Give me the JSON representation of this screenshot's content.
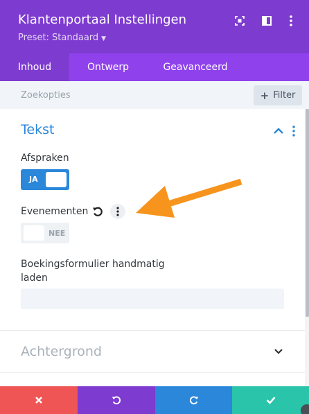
{
  "header": {
    "title": "Klantenportaal Instellingen",
    "preset": "Preset: Standaard",
    "icons": [
      "focus-icon",
      "split-view-icon",
      "more-vertical-icon"
    ]
  },
  "tabs": [
    {
      "label": "Inhoud",
      "active": true
    },
    {
      "label": "Ontwerp",
      "active": false
    },
    {
      "label": "Geavanceerd",
      "active": false
    }
  ],
  "search": {
    "placeholder": "Zoekopties",
    "filter_label": "Filter"
  },
  "section": {
    "title": "Tekst",
    "expanded": true
  },
  "fields": {
    "afspraken": {
      "label": "Afspraken",
      "value": "JA",
      "on": true
    },
    "evenementen": {
      "label": "Evenementen",
      "value": "NEE",
      "on": false
    },
    "boekingsformulier": {
      "label_line1": "Boekingsformulier handmatig",
      "label_line2": "laden",
      "value": ""
    }
  },
  "section2": {
    "title": "Achtergrond",
    "expanded": false
  },
  "footer": {
    "buttons": [
      {
        "name": "discard-button",
        "icon": "close-icon",
        "color": "#ef5555"
      },
      {
        "name": "undo-button",
        "icon": "undo-icon",
        "color": "#7e3bd0"
      },
      {
        "name": "redo-button",
        "icon": "redo-icon",
        "color": "#2b87da"
      },
      {
        "name": "save-button",
        "icon": "check-icon",
        "color": "#29c4a9"
      }
    ]
  },
  "colors": {
    "header": "#7e3bd0",
    "tabs": "#8f42ec",
    "accent": "#2b87da",
    "annotation_arrow": "#f7941d"
  }
}
